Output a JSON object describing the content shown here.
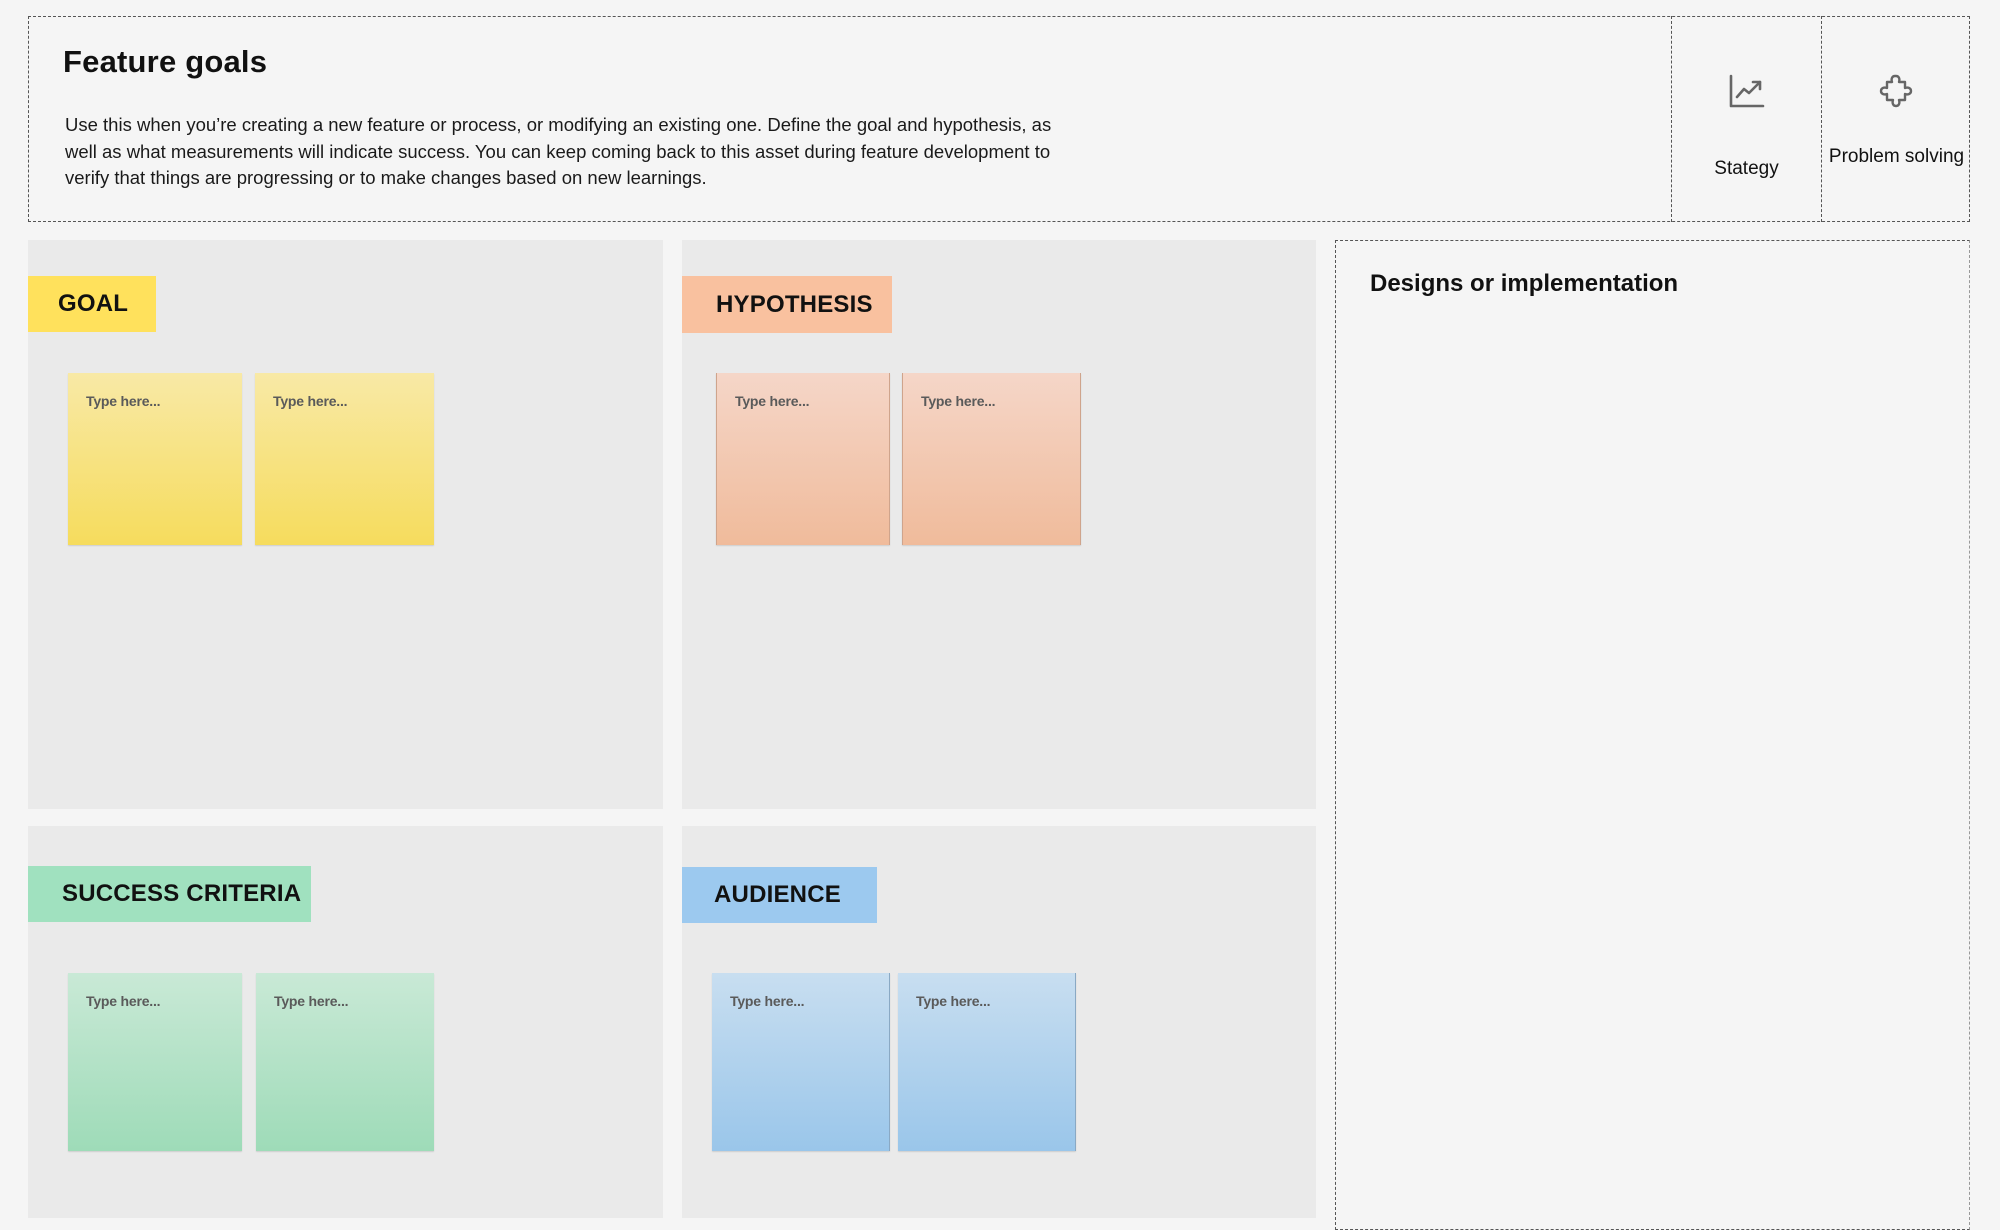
{
  "header": {
    "title": "Feature goals",
    "description": "Use this when you’re creating a new feature or process, or modifying an existing one. Define the goal and hypothesis, as well as what measurements will indicate success. You can keep coming back to this asset during feature development to verify that things are progressing or to make changes based on new learnings.",
    "links": [
      {
        "label": "Stategy",
        "icon": "chart-trend-up-icon"
      },
      {
        "label": "Problem solving",
        "icon": "puzzle-piece-icon"
      }
    ]
  },
  "sections": [
    {
      "id": "goal",
      "label": "GOAL",
      "color": "#ffe15c",
      "notes": [
        "Type here...",
        "Type here..."
      ]
    },
    {
      "id": "hypothesis",
      "label": "HYPOTHESIS",
      "color": "#f9c19f",
      "notes": [
        "Type here...",
        "Type here..."
      ]
    },
    {
      "id": "success-criteria",
      "label": "SUCCESS CRITERIA",
      "color": "#a0e1bf",
      "notes": [
        "Type here...",
        "Type here..."
      ]
    },
    {
      "id": "audience",
      "label": "AUDIENCE",
      "color": "#9cc9ef",
      "notes": [
        "Type here...",
        "Type here..."
      ]
    }
  ],
  "designs": {
    "title": "Designs or implementation"
  }
}
